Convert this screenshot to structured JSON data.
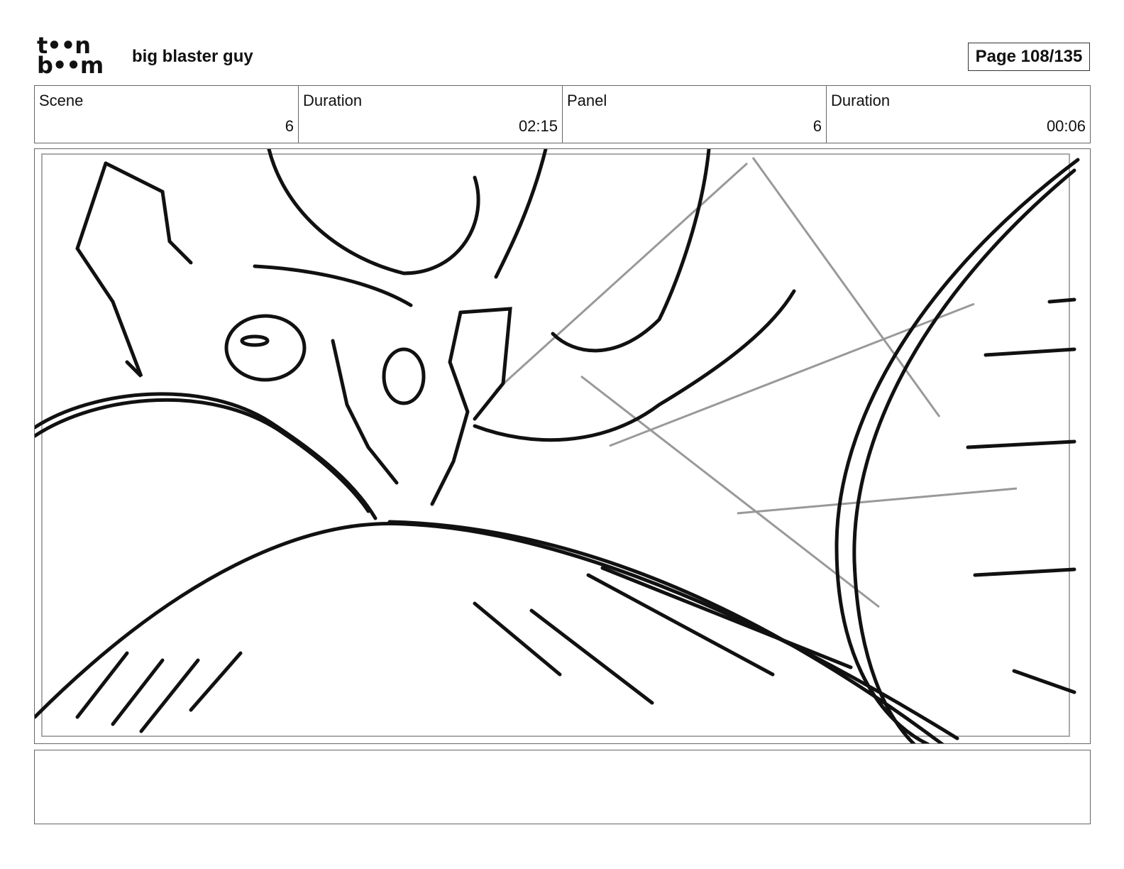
{
  "header": {
    "logo_top": "t••n",
    "logo_bottom": "b••m",
    "project_title": "big blaster guy",
    "page_label": "Page 108/135"
  },
  "info": {
    "scene_label": "Scene",
    "scene_value": "6",
    "scene_duration_label": "Duration",
    "scene_duration_value": "02:15",
    "panel_label": "Panel",
    "panel_value": "6",
    "panel_duration_label": "Duration",
    "panel_duration_value": "00:06"
  },
  "notes": {
    "text": ""
  }
}
